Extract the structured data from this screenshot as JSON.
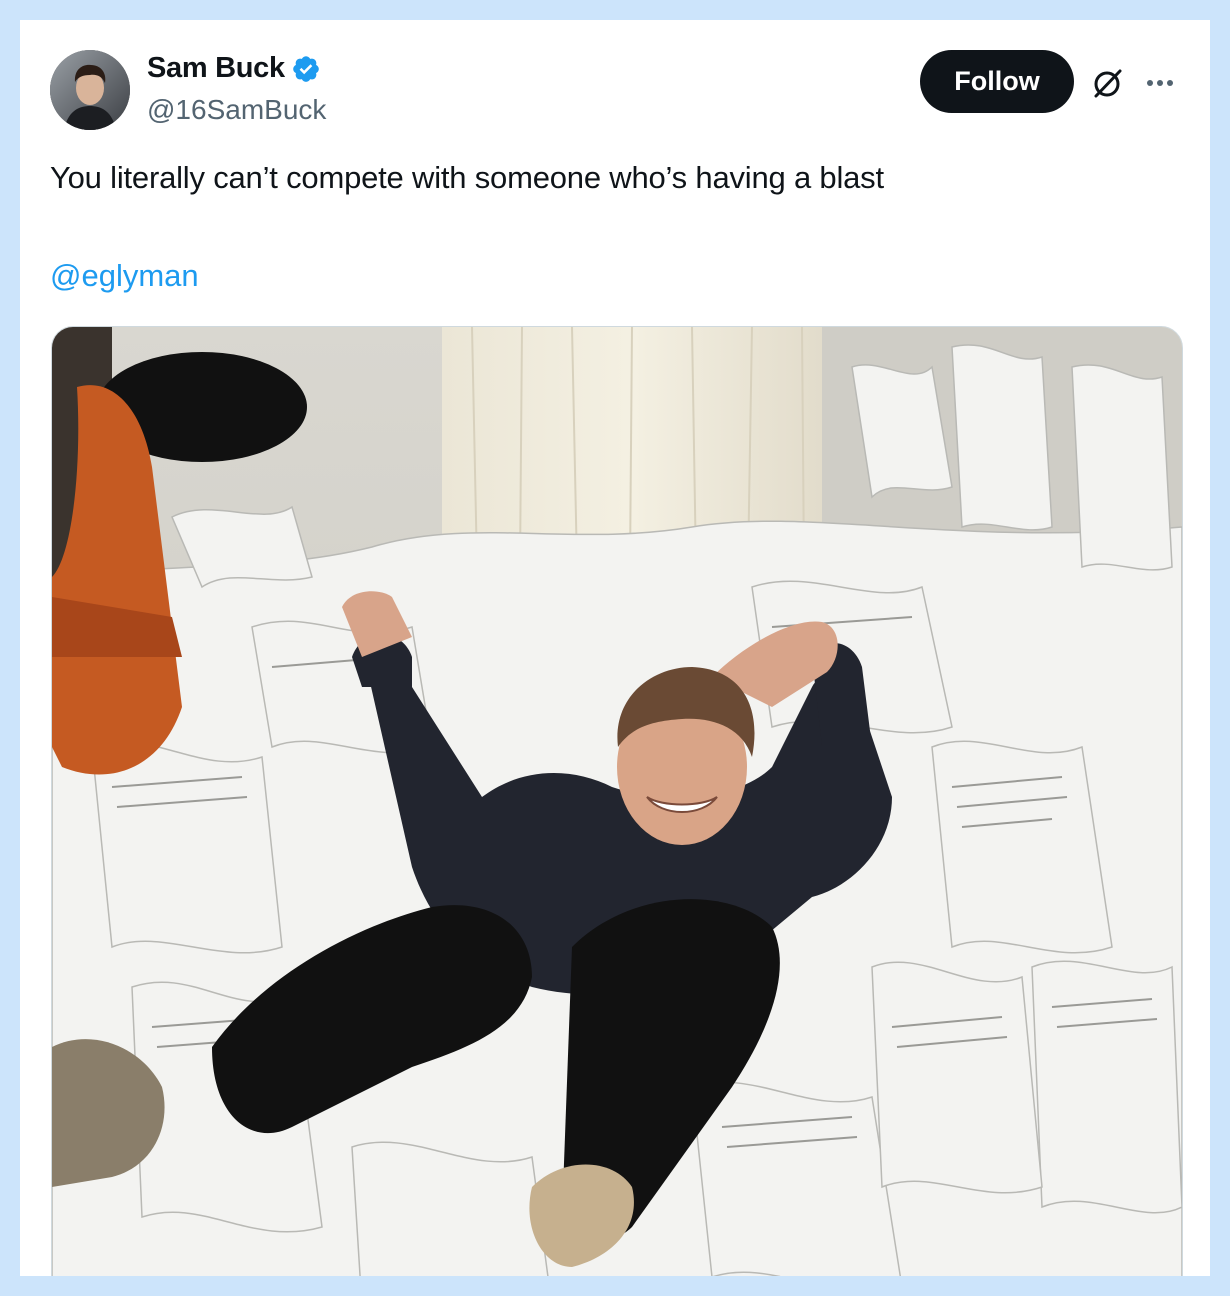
{
  "tweet": {
    "author": {
      "display_name": "Sam Buck",
      "handle": "@16SamBuck",
      "verified": true,
      "verified_color": "#1d9bf0"
    },
    "follow_label": "Follow",
    "text": "You literally can’t compete with someone who’s having a blast",
    "mention": "@eglyman",
    "media": {
      "description_icon": "photo"
    }
  },
  "colors": {
    "background": "#cce4fb",
    "card": "#ffffff",
    "text_primary": "#0f1419",
    "text_secondary": "#536471",
    "link": "#1d9bf0",
    "follow_bg": "#0f1419"
  }
}
